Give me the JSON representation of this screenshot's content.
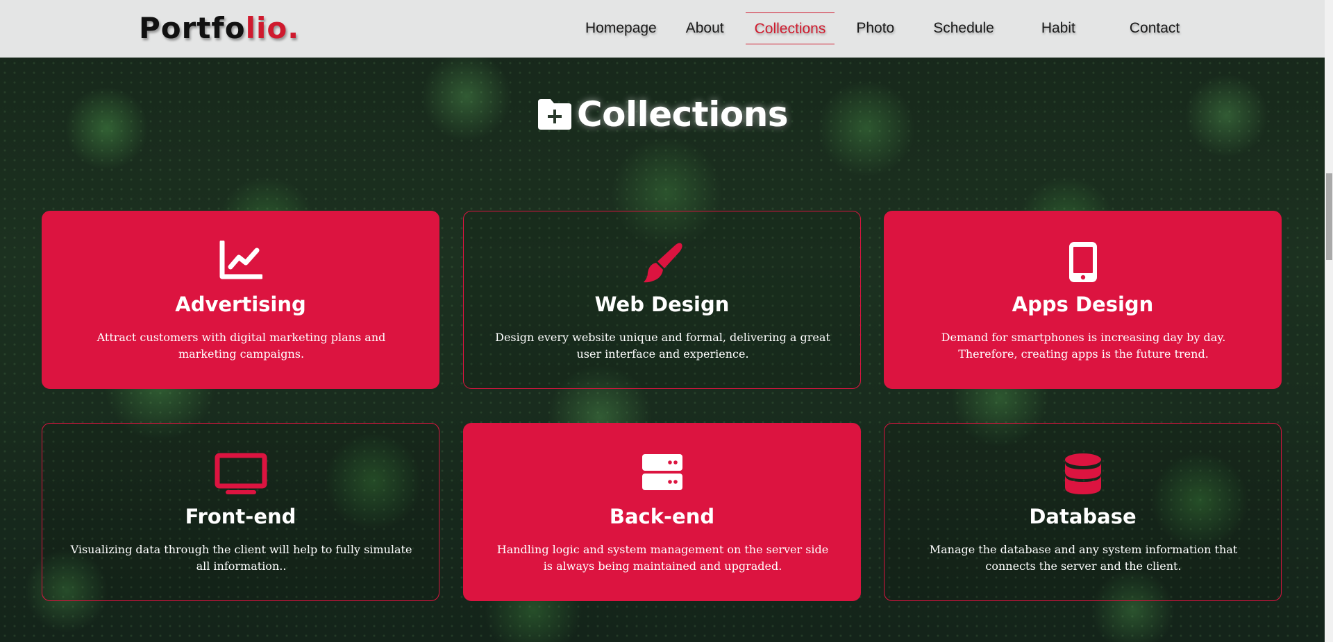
{
  "header": {
    "logo_main": "Portfo",
    "logo_accent": "lio.",
    "nav": [
      {
        "label": "Homepage",
        "active": false
      },
      {
        "label": "About",
        "active": false
      },
      {
        "label": "Collections",
        "active": true
      },
      {
        "label": "Photo",
        "active": false
      },
      {
        "label": "Schedule",
        "active": false
      },
      {
        "label": "Habit",
        "active": false
      },
      {
        "label": "Contact",
        "active": false
      }
    ]
  },
  "section": {
    "title": "Collections",
    "icon": "folder-plus-icon"
  },
  "colors": {
    "accent": "#dc1440",
    "header_bg": "#e4e5e5",
    "active_nav": "#d01a2d"
  },
  "cards": [
    {
      "title": "Advertising",
      "icon": "chart-line-icon",
      "style": "filled",
      "description": "Attract customers with digital marketing plans and marketing campaigns."
    },
    {
      "title": "Web Design",
      "icon": "paintbrush-icon",
      "style": "outline",
      "description": "Design every website unique and formal, delivering a great user interface and experience."
    },
    {
      "title": "Apps Design",
      "icon": "mobile-phone-icon",
      "style": "filled",
      "description": "Demand for smartphones is increasing day by day. Therefore, creating apps is the future trend."
    },
    {
      "title": "Front-end",
      "icon": "monitor-icon",
      "style": "outline",
      "description": "Visualizing data through the client will help to fully simulate all information.."
    },
    {
      "title": "Back-end",
      "icon": "server-icon",
      "style": "filled",
      "description": "Handling logic and system management on the server side is always being maintained and upgraded."
    },
    {
      "title": "Database",
      "icon": "database-icon",
      "style": "outline",
      "description": "Manage the database and any system information that connects the server and the client."
    }
  ]
}
